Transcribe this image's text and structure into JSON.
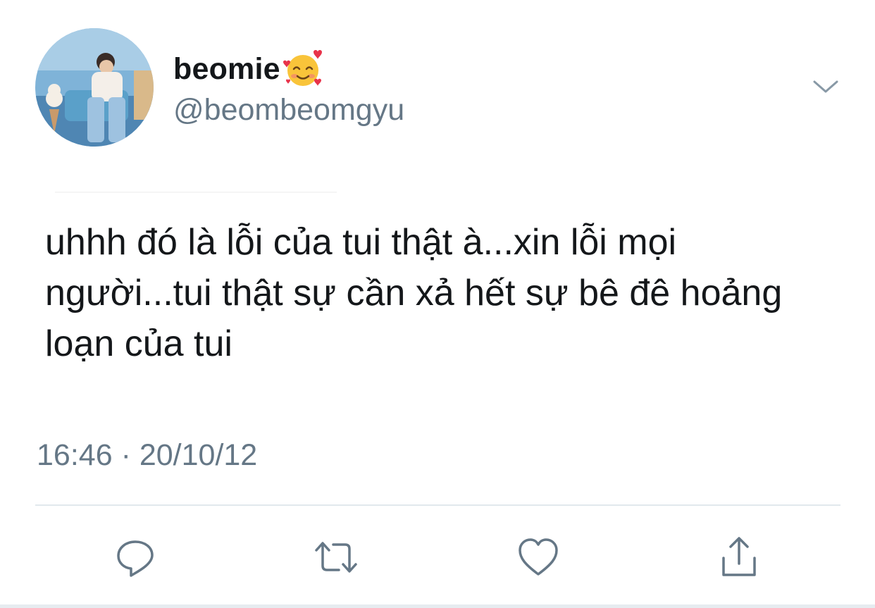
{
  "tweet": {
    "display_name": "beomie",
    "name_emoji": "smiling-face-with-hearts-emoji",
    "handle": "@beombeomgyu",
    "text": "uhhh đó là lỗi của tui thật à...xin lỗi mọi\nngười...tui thật sự cần xả hết sự bê đê hoảng\nloạn của tui",
    "time": "16:46",
    "separator": "·",
    "date": "20/10/12"
  },
  "actions": [
    "reply-icon",
    "retweet-icon",
    "like-icon",
    "share-icon"
  ],
  "colors": {
    "text": "#14171a",
    "secondary": "#657786",
    "icon": "#657786",
    "divider": "#e1e8ed"
  }
}
